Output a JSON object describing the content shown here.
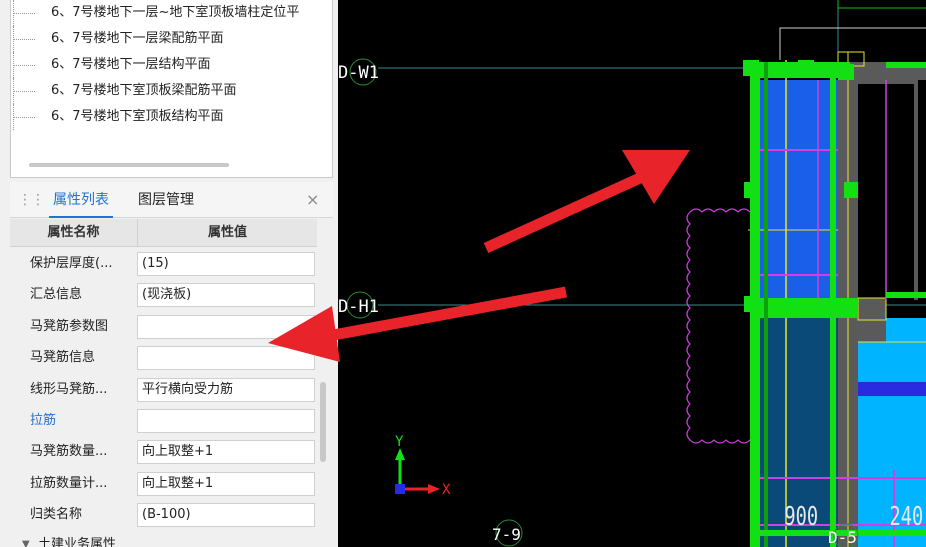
{
  "drawing_tree": {
    "items": [
      {
        "label": "6、7号楼地下一层~地下室顶板墙柱定位平"
      },
      {
        "label": "6、7号楼地下一层梁配筋平面"
      },
      {
        "label": "6、7号楼地下一层结构平面"
      },
      {
        "label": "6、7号楼地下室顶板梁配筋平面"
      },
      {
        "label": "6、7号楼地下室顶板结构平面"
      }
    ]
  },
  "panel_tabs": {
    "properties": "属性列表",
    "layers": "图层管理",
    "close": "×"
  },
  "property_table": {
    "header_name": "属性名称",
    "header_value": "属性值",
    "rows": [
      {
        "name": "保护层厚度(...",
        "value": "(15)"
      },
      {
        "name": "汇总信息",
        "value": "(现浇板)"
      },
      {
        "name": "马凳筋参数图",
        "value": ""
      },
      {
        "name": "马凳筋信息",
        "value": ""
      },
      {
        "name": "线形马凳筋...",
        "value": "平行横向受力筋"
      },
      {
        "name": "拉筋",
        "value": ""
      },
      {
        "name": "马凳筋数量...",
        "value": "向上取整+1"
      },
      {
        "name": "拉筋数量计...",
        "value": "向上取整+1"
      },
      {
        "name": "归类名称",
        "value": "(B-100)"
      }
    ],
    "group_label": "土建业务属性"
  },
  "cad": {
    "axis_label_w1": "D-W1",
    "axis_label_h1": "D-H1",
    "axis_label_79": "7-9",
    "axis_label_d5": "D-5",
    "dim_900": "900",
    "dim_240": "240",
    "ucs_y": "Y",
    "ucs_x": "X"
  },
  "colors": {
    "accent_tab": "#1e74d6",
    "annotation_arrow": "#e8232a",
    "cad_green": "#12e012",
    "cad_blue": "#1a5fe8",
    "cad_cyan": "#00b4ff",
    "cad_magenta": "#d040e0",
    "cad_yellow": "#e6e62e"
  }
}
